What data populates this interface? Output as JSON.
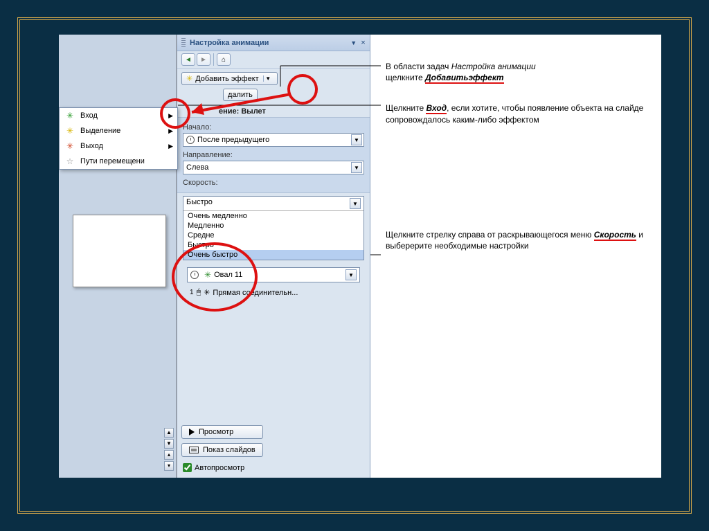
{
  "pane": {
    "title": "Настройка анимации",
    "addEffect": "Добавить эффект",
    "delete": "далить",
    "modifyHeader": "ение: Вылет",
    "startLabel": "Начало:",
    "startValue": "После предыдущего",
    "directionLabel": "Направление:",
    "directionValue": "Слева",
    "speedLabel": "Скорость:",
    "speedSelected": "Быстро",
    "speedOptions": [
      "Очень медленно",
      "Медленно",
      "Средне",
      "Быстро",
      "Очень быстро"
    ],
    "animItem1": "Овал 11",
    "animItem2": "Прямая соединительн...",
    "preview": "Просмотр",
    "slideshow": "Показ слайдов",
    "autopreview": "Автопросмотр"
  },
  "contextMenu": {
    "items": [
      {
        "icon": "✳",
        "color": "#2a9a2a",
        "label": "Вход"
      },
      {
        "icon": "✳",
        "color": "#d6b400",
        "label": "Выделение"
      },
      {
        "icon": "✳",
        "color": "#d14a2a",
        "label": "Выход"
      },
      {
        "icon": "☆",
        "color": "#888",
        "label": "Пути перемещени"
      }
    ]
  },
  "callouts": {
    "c1a": "В области задач ",
    "c1b": "Настройка анимации",
    "c1c": " щелкните ",
    "c1d": "Добавитьэффект",
    "c2a": "Щелкните ",
    "c2b": "Вход",
    "c2c": ", если хотите, чтобы появление объекта на слайде сопровождалось каким-либо эффектом",
    "c3a": "Щелкните стрелку справа от раскрывающегося меню ",
    "c3b": "Скорость",
    "c3c": " и выберерите необходимые настройки"
  }
}
